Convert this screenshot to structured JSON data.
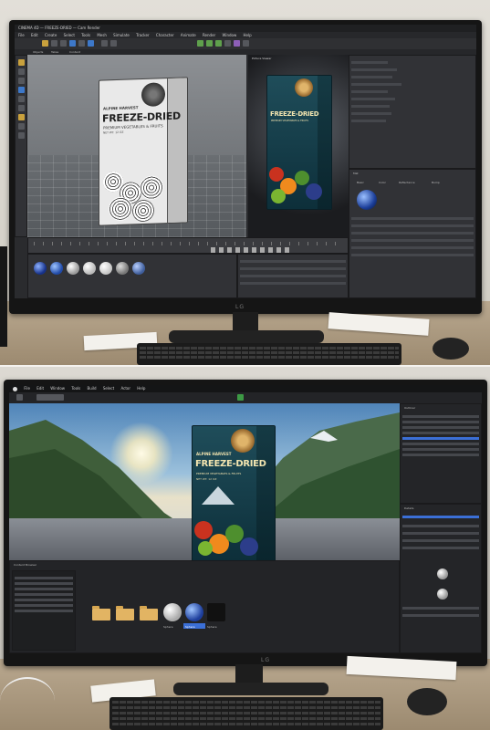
{
  "photo_top": {
    "monitor_brand": "LG",
    "app_title": "CINEMA 4D — FREEZE-DRIED — Cam Render",
    "menu": [
      "File",
      "Edit",
      "Create",
      "Select",
      "Tools",
      "Mesh",
      "Simulate",
      "Tracker",
      "Character",
      "Animate",
      "Render",
      "Window",
      "Help"
    ],
    "render_label": "Picture Viewer",
    "panel_tabs": [
      "Objects",
      "Takes",
      "Content"
    ],
    "material_label": "Mat",
    "attribute_tabs": [
      "Basic",
      "Color",
      "Reflectance",
      "Bump"
    ]
  },
  "photo_bottom": {
    "monitor_brand": "LG",
    "menu": [
      "File",
      "Edit",
      "Window",
      "Tools",
      "Build",
      "Select",
      "Actor",
      "Help"
    ],
    "outliner_label": "Outliner",
    "details_label": "Details",
    "content_browser_label": "Content Browser",
    "asset_labels": [
      "",
      "",
      "",
      "Sphere",
      "Sphere",
      "Sphere"
    ]
  },
  "package": {
    "brand": "ALPINE HARVEST",
    "title": "FREEZE-DRIED",
    "subtitle": "PREMIUM VEGETABLES & FRUITS",
    "net": "NET WT. 12 OZ"
  },
  "colors": {
    "package_teal": "#1f4d5a",
    "ui_dark": "#2a2b2e",
    "accent_blue": "#3b6fd6"
  }
}
